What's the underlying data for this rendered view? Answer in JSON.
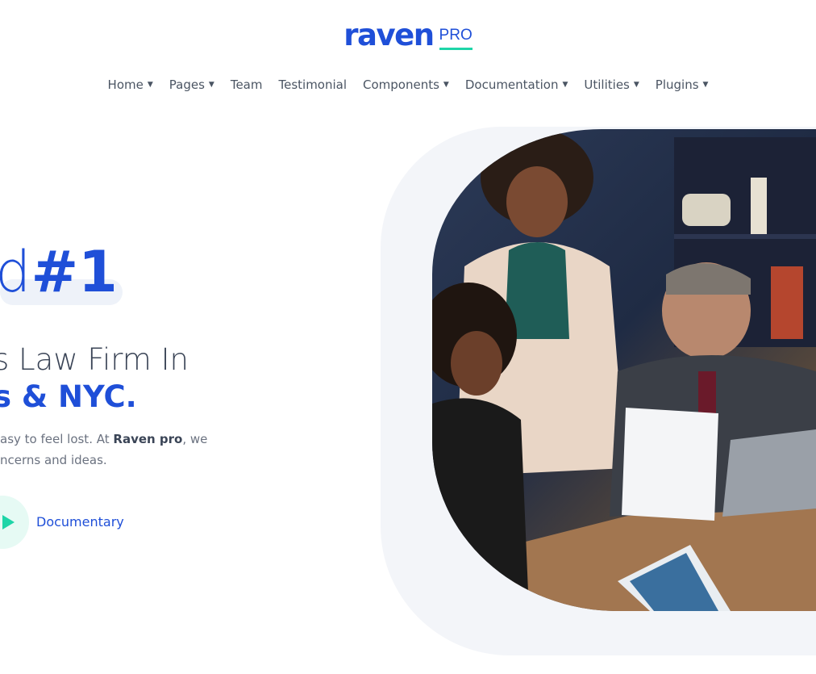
{
  "brand": {
    "name": "raven",
    "suffix": "PRO"
  },
  "nav": {
    "items": [
      {
        "label": "Home",
        "dropdown": true
      },
      {
        "label": "Pages",
        "dropdown": true
      },
      {
        "label": "Team",
        "dropdown": false
      },
      {
        "label": "Testimonial",
        "dropdown": false
      },
      {
        "label": "Components",
        "dropdown": true
      },
      {
        "label": "Documentation",
        "dropdown": true
      },
      {
        "label": "Utilities",
        "dropdown": true
      },
      {
        "label": "Plugins",
        "dropdown": true
      }
    ]
  },
  "hero": {
    "headline_light": "d",
    "headline_bold": "#1",
    "subheading_line1": "s Law Firm In",
    "subheading_line2": "s & NYC.",
    "paragraph_line1_prefix": "asy to feel lost. At ",
    "paragraph_brand": "Raven pro",
    "paragraph_line1_suffix": ", we",
    "paragraph_line2": "ncerns and ideas.",
    "video_link": "Documentary"
  },
  "image": {
    "description_icon": "business-meeting-photo"
  },
  "colors": {
    "primary": "#1f4fd8",
    "accent": "#1ed5a8"
  }
}
